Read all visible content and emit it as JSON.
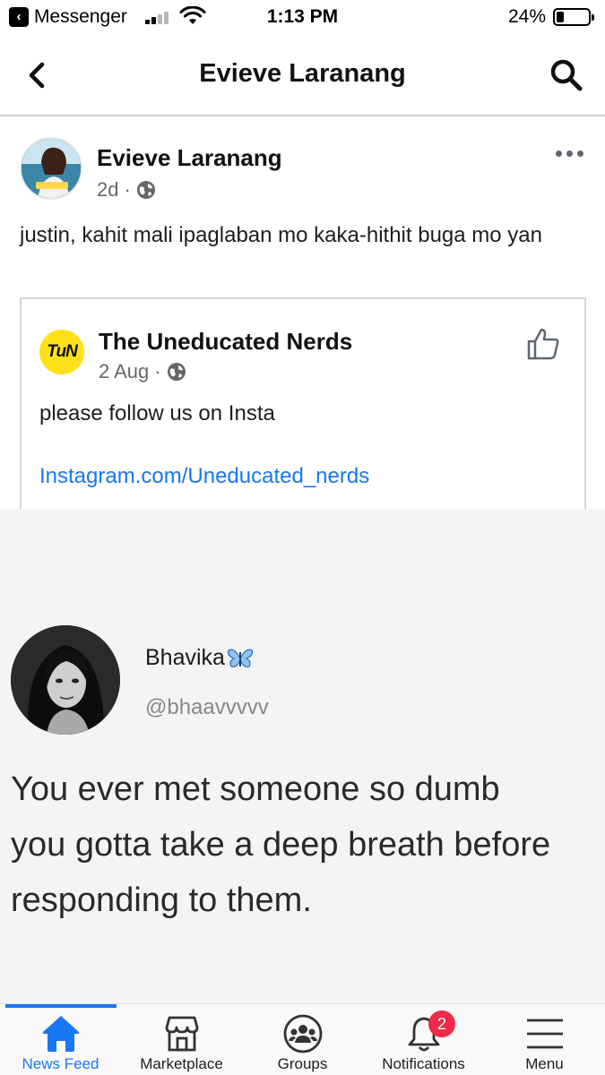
{
  "status_bar": {
    "back_app": "Messenger",
    "time": "1:13 PM",
    "battery_percent": "24%",
    "battery_level": 0.24
  },
  "header": {
    "title": "Evieve Laranang"
  },
  "post": {
    "author": "Evieve Laranang",
    "time": "2d",
    "text": "justin, kahit mali ipaglaban mo kaka-hithit buga mo yan"
  },
  "shared_post": {
    "logo_text": "TuN",
    "page_name": "The Uneducated Nerds",
    "date": "2 Aug",
    "text": "please follow us on Insta",
    "link": "Instagram.com/Uneducated_nerds"
  },
  "tweet_image": {
    "name": "Bhavika",
    "handle": "@bhaavvvvv",
    "text_lines": [
      "You ever met someone so dumb",
      "you gotta take a deep breath before",
      "responding to them."
    ]
  },
  "tab_bar": {
    "tabs": [
      {
        "label": "News Feed",
        "icon": "home-icon",
        "active": true
      },
      {
        "label": "Marketplace",
        "icon": "marketplace-icon"
      },
      {
        "label": "Groups",
        "icon": "groups-icon"
      },
      {
        "label": "Notifications",
        "icon": "bell-icon",
        "badge": "2"
      },
      {
        "label": "Menu",
        "icon": "menu-icon"
      }
    ]
  },
  "colors": {
    "accent": "#1877f2",
    "badge": "#f02849",
    "meta_text": "#65676b"
  }
}
